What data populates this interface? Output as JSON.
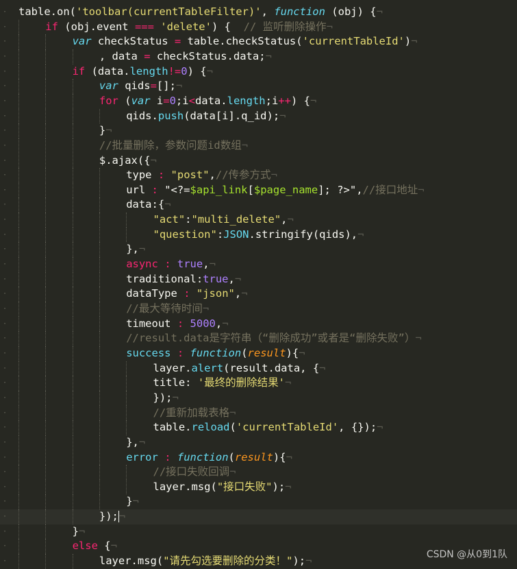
{
  "editor": {
    "theme_colors": {
      "background": "#272822",
      "keyword": "#F92672",
      "string": "#E6DB74",
      "number": "#AE81FF",
      "function": "#66D9EF",
      "parameter": "#FD971F",
      "comment": "#75715E",
      "text": "#F8F8F2"
    },
    "cursor_line": 34,
    "lines": [
      {
        "indent": 0,
        "tokens": [
          [
            "plain",
            "table.on("
          ],
          [
            "str",
            "'toolbar(currentTableFilter)'"
          ],
          [
            "plain",
            ", "
          ],
          [
            "storage",
            "function"
          ],
          [
            "plain",
            " (obj) {"
          ],
          [
            "ws",
            "¬"
          ]
        ]
      },
      {
        "indent": 1,
        "tokens": [
          [
            "kw",
            "if"
          ],
          [
            "plain",
            " (obj.event "
          ],
          [
            "kw",
            "==="
          ],
          [
            "plain",
            " "
          ],
          [
            "str",
            "'delete'"
          ],
          [
            "plain",
            ") {  "
          ],
          [
            "com",
            "// 监听删除操作"
          ],
          [
            "ws",
            "¬"
          ]
        ]
      },
      {
        "indent": 2,
        "tokens": [
          [
            "storage",
            "var"
          ],
          [
            "plain",
            " checkStatus "
          ],
          [
            "kw",
            "="
          ],
          [
            "plain",
            " table.checkStatus("
          ],
          [
            "str",
            "'currentTableId'"
          ],
          [
            "plain",
            ")"
          ],
          [
            "ws",
            "¬"
          ]
        ]
      },
      {
        "indent": 3,
        "tokens": [
          [
            "plain",
            ", data "
          ],
          [
            "kw",
            "="
          ],
          [
            "plain",
            " checkStatus.data;"
          ],
          [
            "ws",
            "¬"
          ]
        ]
      },
      {
        "indent": 2,
        "tokens": [
          [
            "kw",
            "if"
          ],
          [
            "plain",
            " (data."
          ],
          [
            "prop",
            "length"
          ],
          [
            "kw",
            "!="
          ],
          [
            "num",
            "0"
          ],
          [
            "plain",
            ") {"
          ],
          [
            "ws",
            "¬"
          ]
        ]
      },
      {
        "indent": 3,
        "tokens": [
          [
            "storage",
            "var"
          ],
          [
            "plain",
            " qids"
          ],
          [
            "kw",
            "="
          ],
          [
            "plain",
            "[];"
          ],
          [
            "ws",
            "¬"
          ]
        ]
      },
      {
        "indent": 3,
        "tokens": [
          [
            "kw",
            "for"
          ],
          [
            "plain",
            " ("
          ],
          [
            "storage",
            "var"
          ],
          [
            "plain",
            " i"
          ],
          [
            "kw",
            "="
          ],
          [
            "num",
            "0"
          ],
          [
            "plain",
            ";i"
          ],
          [
            "kw",
            "<"
          ],
          [
            "plain",
            "data."
          ],
          [
            "prop",
            "length"
          ],
          [
            "plain",
            ";i"
          ],
          [
            "kw",
            "++"
          ],
          [
            "plain",
            ") {"
          ],
          [
            "ws",
            "¬"
          ]
        ]
      },
      {
        "indent": 4,
        "tokens": [
          [
            "plain",
            "qids."
          ],
          [
            "fn",
            "push"
          ],
          [
            "plain",
            "(data[i].q_id);"
          ],
          [
            "ws",
            "¬"
          ]
        ]
      },
      {
        "indent": 3,
        "tokens": [
          [
            "plain",
            "}"
          ],
          [
            "ws",
            "¬"
          ]
        ]
      },
      {
        "indent": 3,
        "tokens": [
          [
            "com",
            "//批量删除，参数问题id数组"
          ],
          [
            "ws",
            "¬"
          ]
        ]
      },
      {
        "indent": 3,
        "tokens": [
          [
            "plain",
            "$.ajax({"
          ],
          [
            "ws",
            "¬"
          ]
        ]
      },
      {
        "indent": 4,
        "tokens": [
          [
            "plain",
            "type "
          ],
          [
            "kw",
            ":"
          ],
          [
            "plain",
            " "
          ],
          [
            "str",
            "\"post\""
          ],
          [
            "plain",
            ","
          ],
          [
            "com",
            "//传参方式"
          ],
          [
            "ws",
            "¬"
          ]
        ]
      },
      {
        "indent": 4,
        "tokens": [
          [
            "plain",
            "url "
          ],
          [
            "kw",
            ":"
          ],
          [
            "plain",
            " \"<?="
          ],
          [
            "var",
            "$api_link"
          ],
          [
            "plain",
            "["
          ],
          [
            "var",
            "$page_name"
          ],
          [
            "plain",
            "]; ?>\","
          ],
          [
            "com",
            "//接口地址"
          ],
          [
            "ws",
            "¬"
          ]
        ]
      },
      {
        "indent": 4,
        "tokens": [
          [
            "plain",
            "data:{"
          ],
          [
            "ws",
            "¬"
          ]
        ]
      },
      {
        "indent": 5,
        "tokens": [
          [
            "str",
            "\"act\""
          ],
          [
            "plain",
            ":"
          ],
          [
            "str",
            "\"multi_delete\""
          ],
          [
            "plain",
            ","
          ],
          [
            "ws",
            "¬"
          ]
        ]
      },
      {
        "indent": 5,
        "tokens": [
          [
            "str",
            "\"question\""
          ],
          [
            "plain",
            ":"
          ],
          [
            "prop",
            "JSON"
          ],
          [
            "plain",
            ".stringify(qids),"
          ],
          [
            "ws",
            "¬"
          ]
        ]
      },
      {
        "indent": 4,
        "tokens": [
          [
            "plain",
            "},"
          ],
          [
            "ws",
            "¬"
          ]
        ]
      },
      {
        "indent": 4,
        "tokens": [
          [
            "kw",
            "async"
          ],
          [
            "plain",
            " "
          ],
          [
            "kw",
            ":"
          ],
          [
            "plain",
            " "
          ],
          [
            "num",
            "true"
          ],
          [
            "plain",
            ","
          ],
          [
            "ws",
            "¬"
          ]
        ]
      },
      {
        "indent": 4,
        "tokens": [
          [
            "plain",
            "traditional:"
          ],
          [
            "num",
            "true"
          ],
          [
            "plain",
            ","
          ],
          [
            "ws",
            "¬"
          ]
        ]
      },
      {
        "indent": 4,
        "tokens": [
          [
            "plain",
            "dataType "
          ],
          [
            "kw",
            ":"
          ],
          [
            "plain",
            " "
          ],
          [
            "str",
            "\"json\""
          ],
          [
            "plain",
            ","
          ],
          [
            "ws",
            "¬"
          ]
        ]
      },
      {
        "indent": 4,
        "tokens": [
          [
            "com",
            "//最大等待时间"
          ],
          [
            "ws",
            "¬"
          ]
        ]
      },
      {
        "indent": 4,
        "tokens": [
          [
            "plain",
            "timeout "
          ],
          [
            "kw",
            ":"
          ],
          [
            "plain",
            " "
          ],
          [
            "num",
            "5000"
          ],
          [
            "plain",
            ","
          ],
          [
            "ws",
            "¬"
          ]
        ]
      },
      {
        "indent": 4,
        "tokens": [
          [
            "com",
            "//result.data是字符串（“删除成功”或者是“删除失败”）"
          ],
          [
            "ws",
            "¬"
          ]
        ]
      },
      {
        "indent": 4,
        "tokens": [
          [
            "fn",
            "success"
          ],
          [
            "plain",
            " "
          ],
          [
            "kw",
            ":"
          ],
          [
            "plain",
            " "
          ],
          [
            "storage",
            "function"
          ],
          [
            "plain",
            "("
          ],
          [
            "param",
            "result"
          ],
          [
            "plain",
            "){"
          ],
          [
            "ws",
            "¬"
          ]
        ]
      },
      {
        "indent": 5,
        "tokens": [
          [
            "plain",
            "layer."
          ],
          [
            "fn",
            "alert"
          ],
          [
            "plain",
            "(result.data, {"
          ],
          [
            "ws",
            "¬"
          ]
        ]
      },
      {
        "indent": 5,
        "tokens": [
          [
            "plain",
            "title: "
          ],
          [
            "str",
            "'最终的删除结果'"
          ],
          [
            "ws",
            "¬"
          ]
        ]
      },
      {
        "indent": 5,
        "tokens": [
          [
            "plain",
            "});"
          ],
          [
            "ws",
            "¬"
          ]
        ]
      },
      {
        "indent": 5,
        "tokens": [
          [
            "com",
            "//重新加载表格"
          ],
          [
            "ws",
            "¬"
          ]
        ]
      },
      {
        "indent": 5,
        "tokens": [
          [
            "plain",
            "table."
          ],
          [
            "fn",
            "reload"
          ],
          [
            "plain",
            "("
          ],
          [
            "str",
            "'currentTableId'"
          ],
          [
            "plain",
            ", {});"
          ],
          [
            "ws",
            "¬"
          ]
        ]
      },
      {
        "indent": 4,
        "tokens": [
          [
            "plain",
            "},"
          ],
          [
            "ws",
            "¬"
          ]
        ]
      },
      {
        "indent": 4,
        "tokens": [
          [
            "fn",
            "error"
          ],
          [
            "plain",
            " "
          ],
          [
            "kw",
            ":"
          ],
          [
            "plain",
            " "
          ],
          [
            "storage",
            "function"
          ],
          [
            "plain",
            "("
          ],
          [
            "param",
            "result"
          ],
          [
            "plain",
            "){"
          ],
          [
            "ws",
            "¬"
          ]
        ]
      },
      {
        "indent": 5,
        "tokens": [
          [
            "com",
            "//接口失败回调"
          ],
          [
            "ws",
            "¬"
          ]
        ]
      },
      {
        "indent": 5,
        "tokens": [
          [
            "plain",
            "layer.msg("
          ],
          [
            "str",
            "\"接口失败\""
          ],
          [
            "plain",
            ");"
          ],
          [
            "ws",
            "¬"
          ]
        ]
      },
      {
        "indent": 4,
        "tokens": [
          [
            "plain",
            "}"
          ],
          [
            "ws",
            "¬"
          ]
        ]
      },
      {
        "indent": 3,
        "tokens": [
          [
            "plain",
            "});"
          ],
          [
            "cursor",
            ""
          ],
          [
            "ws",
            "¬"
          ]
        ]
      },
      {
        "indent": 2,
        "tokens": [
          [
            "plain",
            "}"
          ],
          [
            "ws",
            "¬"
          ]
        ]
      },
      {
        "indent": 2,
        "tokens": [
          [
            "kw",
            "else"
          ],
          [
            "plain",
            " {"
          ],
          [
            "ws",
            "¬"
          ]
        ]
      },
      {
        "indent": 3,
        "tokens": [
          [
            "plain",
            "layer.msg("
          ],
          [
            "str",
            "\"请先勾选要删除的分类！\""
          ],
          [
            "plain",
            ");"
          ],
          [
            "ws",
            "¬"
          ]
        ]
      }
    ]
  },
  "watermark": "CSDN @从0到1队"
}
